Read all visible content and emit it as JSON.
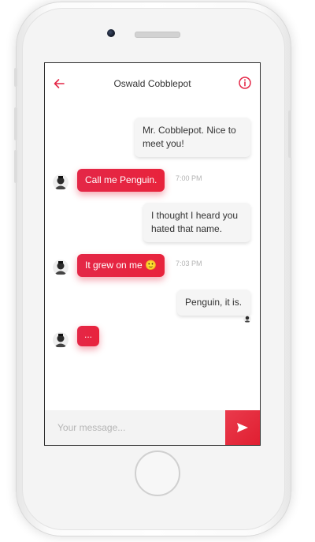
{
  "colors": {
    "accent": "#e42747",
    "incoming_bubble": "#e8233c",
    "outgoing_bubble": "#f5f5f5",
    "timestamp": "#b3b3b3"
  },
  "header": {
    "back_icon": "arrow-left-icon",
    "title": "Oswald Cobblepot",
    "info_icon": "info-circle-icon"
  },
  "messages": [
    {
      "direction": "outgoing",
      "lines": [
        "Mr. Cobblepot. Nice to",
        "meet you!"
      ]
    },
    {
      "direction": "incoming",
      "text": "Call me Penguin.",
      "time": "7:00 PM"
    },
    {
      "direction": "outgoing",
      "lines": [
        "I thought I heard you",
        "hated that name."
      ]
    },
    {
      "direction": "incoming",
      "text": "It grew on me",
      "emoji": "🙂",
      "time": "7:03 PM"
    },
    {
      "direction": "outgoing",
      "text": "Penguin, it is."
    },
    {
      "direction": "incoming",
      "typing": "..."
    }
  ],
  "composer": {
    "placeholder": "Your message...",
    "value": "",
    "send_icon": "send-icon"
  }
}
